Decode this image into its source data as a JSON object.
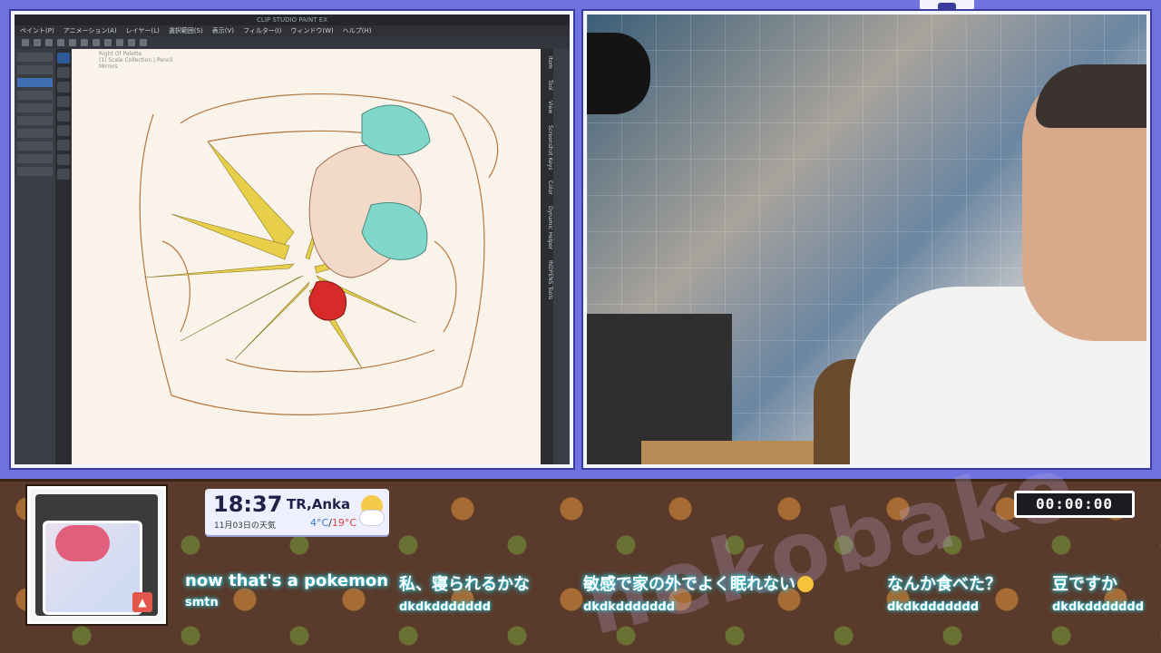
{
  "app": {
    "title": "CLIP STUDIO PAINT EX",
    "menu": [
      "ペイント(P)",
      "アニメーション(A)",
      "レイヤー(L)",
      "選択範囲(S)",
      "表示(V)",
      "フィルター(I)",
      "ウィンドウ(W)",
      "ヘルプ(H)"
    ],
    "canvas_info": [
      "Right Of Palette",
      "(1) Scale Collection | Pencil",
      "Mirrors"
    ],
    "right_tabs": [
      "Item",
      "Tool",
      "View",
      "Screenshot Keys",
      "Color",
      "Dynamic Helper",
      "INDPENS Tools"
    ]
  },
  "overlay": {
    "weather": {
      "time": "18:37",
      "location": "TR,Anka",
      "date": "11月03日の天気",
      "temp_low": "4°C",
      "temp_sep": "/",
      "temp_high": "19°C",
      "icon": "partly-cloudy-icon"
    },
    "timer": "00:00:00",
    "chat": [
      {
        "text": "now that's a pokemon",
        "user": "smtn"
      },
      {
        "text": "私、寝られるかな",
        "user": "dkdkddddddd"
      },
      {
        "text": "敏感で家の外でよく眠れない",
        "user": "dkdkddddddd",
        "emoji": "crying-face-icon"
      },
      {
        "text": "なんか食べた？",
        "user": "dkdkddddddd"
      },
      {
        "text": "豆ですか",
        "user": "dkdkddddddd"
      }
    ],
    "watermark": "nekobako",
    "colors": {
      "top_background": "#6f72e0",
      "bottom_background": "#5a3a2a",
      "chat_glow": "#2fd5e6"
    }
  }
}
